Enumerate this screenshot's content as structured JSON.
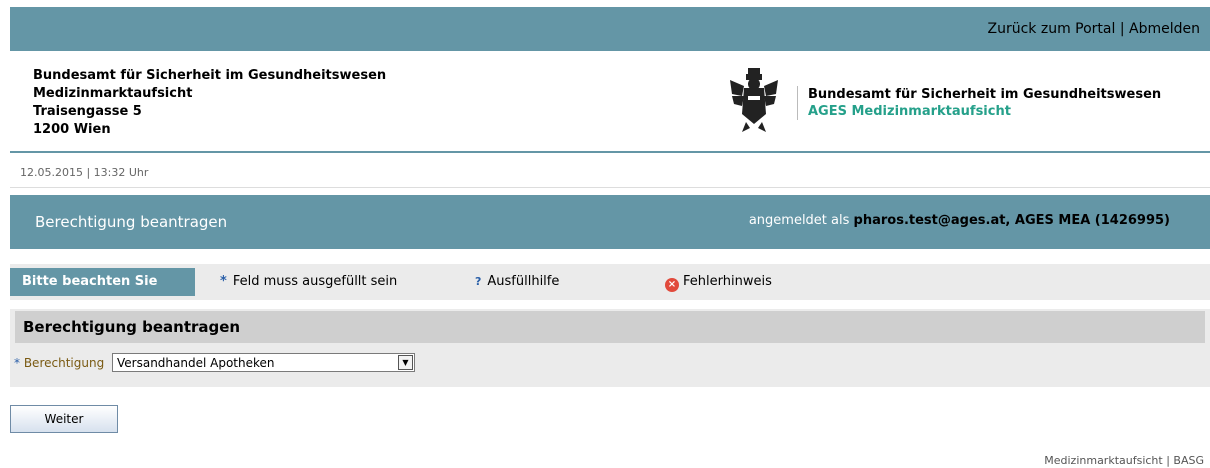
{
  "topbar": {
    "portal_link": "Zurück zum Portal",
    "separator": "|",
    "logout_link": "Abmelden"
  },
  "address": {
    "line1": "Bundesamt für Sicherheit im Gesundheitswesen",
    "line2": "Medizinmarktaufsicht",
    "line3": "Traisengasse 5",
    "line4": "1200 Wien"
  },
  "org": {
    "name": "Bundesamt für Sicherheit im Gesundheitswesen",
    "subtitle": "AGES Medizinmarktaufsicht"
  },
  "datetime": "12.05.2015 | 13:32 Uhr",
  "page": {
    "title": "Berechtigung beantragen",
    "user_prefix": "angemeldet als",
    "user_name": "pharos.test@ages.at, AGES MEA (1426995)"
  },
  "legend": {
    "tag": "Bitte beachten Sie",
    "required_marker": "*",
    "required_text": "Feld muss ausgefüllt sein",
    "help_marker": "?",
    "help_text": "Ausfüllhilfe",
    "error_text": "Fehlerhinweis"
  },
  "form": {
    "section_title": "Berechtigung beantragen",
    "field_marker": "*",
    "field_label": "Berechtigung",
    "field_value": "Versandhandel Apotheken"
  },
  "buttons": {
    "next": "Weiter"
  },
  "footer": "Medizinmarktaufsicht | BASG",
  "colors": {
    "accent": "#6496a6",
    "subtitle_green": "#25a08a",
    "error_red": "#e14a3c"
  }
}
